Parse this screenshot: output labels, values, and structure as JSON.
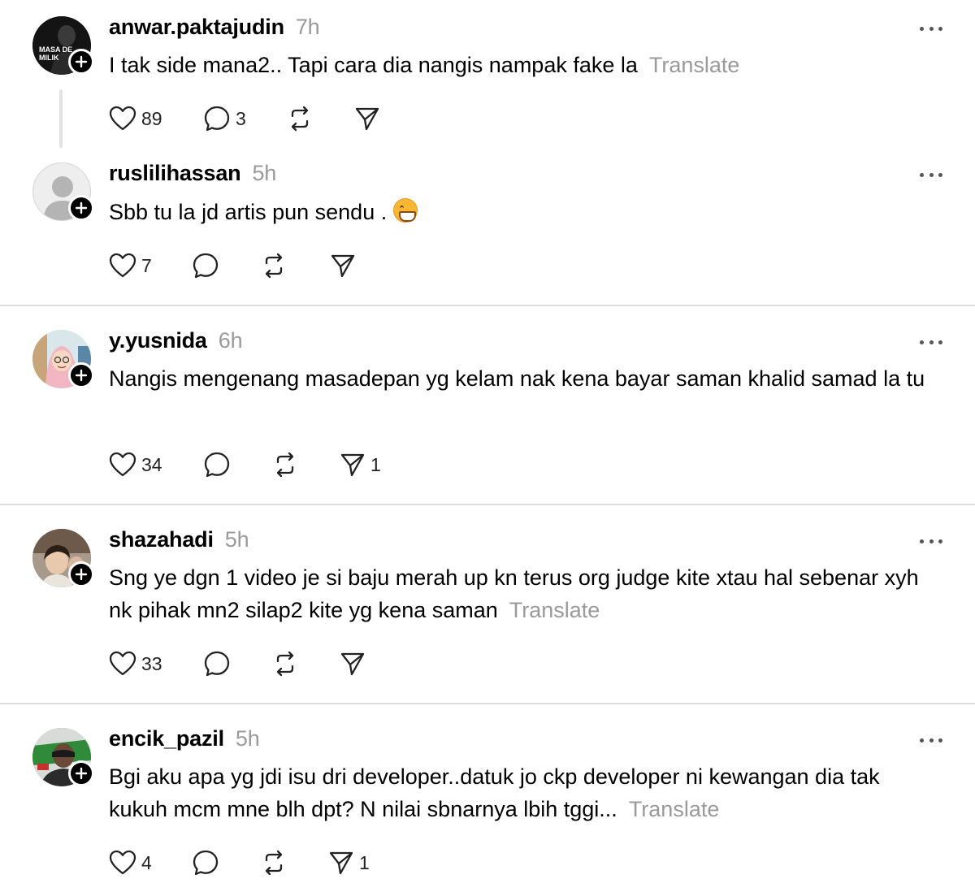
{
  "comments": [
    {
      "username": "anwar.paktajudin",
      "time": "7h",
      "text": "I tak side mana2.. Tapi cara dia nangis nampak fake la",
      "translate": "Translate",
      "likes": "89",
      "replies": "3",
      "reposts": "",
      "shares": "",
      "avatar_text": "MASA DE MILIK"
    },
    {
      "username": "ruslilihassan",
      "time": "5h",
      "text": "Sbb tu la jd artis pun sendu .",
      "translate": "",
      "likes": "7",
      "replies": "",
      "reposts": "",
      "shares": ""
    },
    {
      "username": "y.yusnida",
      "time": "6h",
      "text": "Nangis mengenang masadepan yg kelam nak kena bayar saman khalid samad la tu",
      "translate": "",
      "likes": "34",
      "replies": "",
      "reposts": "",
      "shares": "1"
    },
    {
      "username": "shazahadi",
      "time": "5h",
      "text": "Sng ye dgn 1 video je si baju merah up kn terus org judge kite xtau hal sebenar xyh nk pihak mn2 silap2 kite yg kena saman",
      "translate": "Translate",
      "likes": "33",
      "replies": "",
      "reposts": "",
      "shares": ""
    },
    {
      "username": "encik_pazil",
      "time": "5h",
      "text": "Bgi aku apa yg jdi isu dri developer..datuk jo ckp developer ni kewangan dia tak kukuh mcm mne blh dpt? N nilai sbnarnya lbih tggi...",
      "translate": "Translate",
      "likes": "4",
      "replies": "",
      "reposts": "",
      "shares": "1"
    }
  ],
  "icons": {
    "like": "heart-icon",
    "reply": "comment-icon",
    "repost": "repost-icon",
    "share": "send-icon",
    "more": "more-icon",
    "follow": "plus-icon"
  }
}
